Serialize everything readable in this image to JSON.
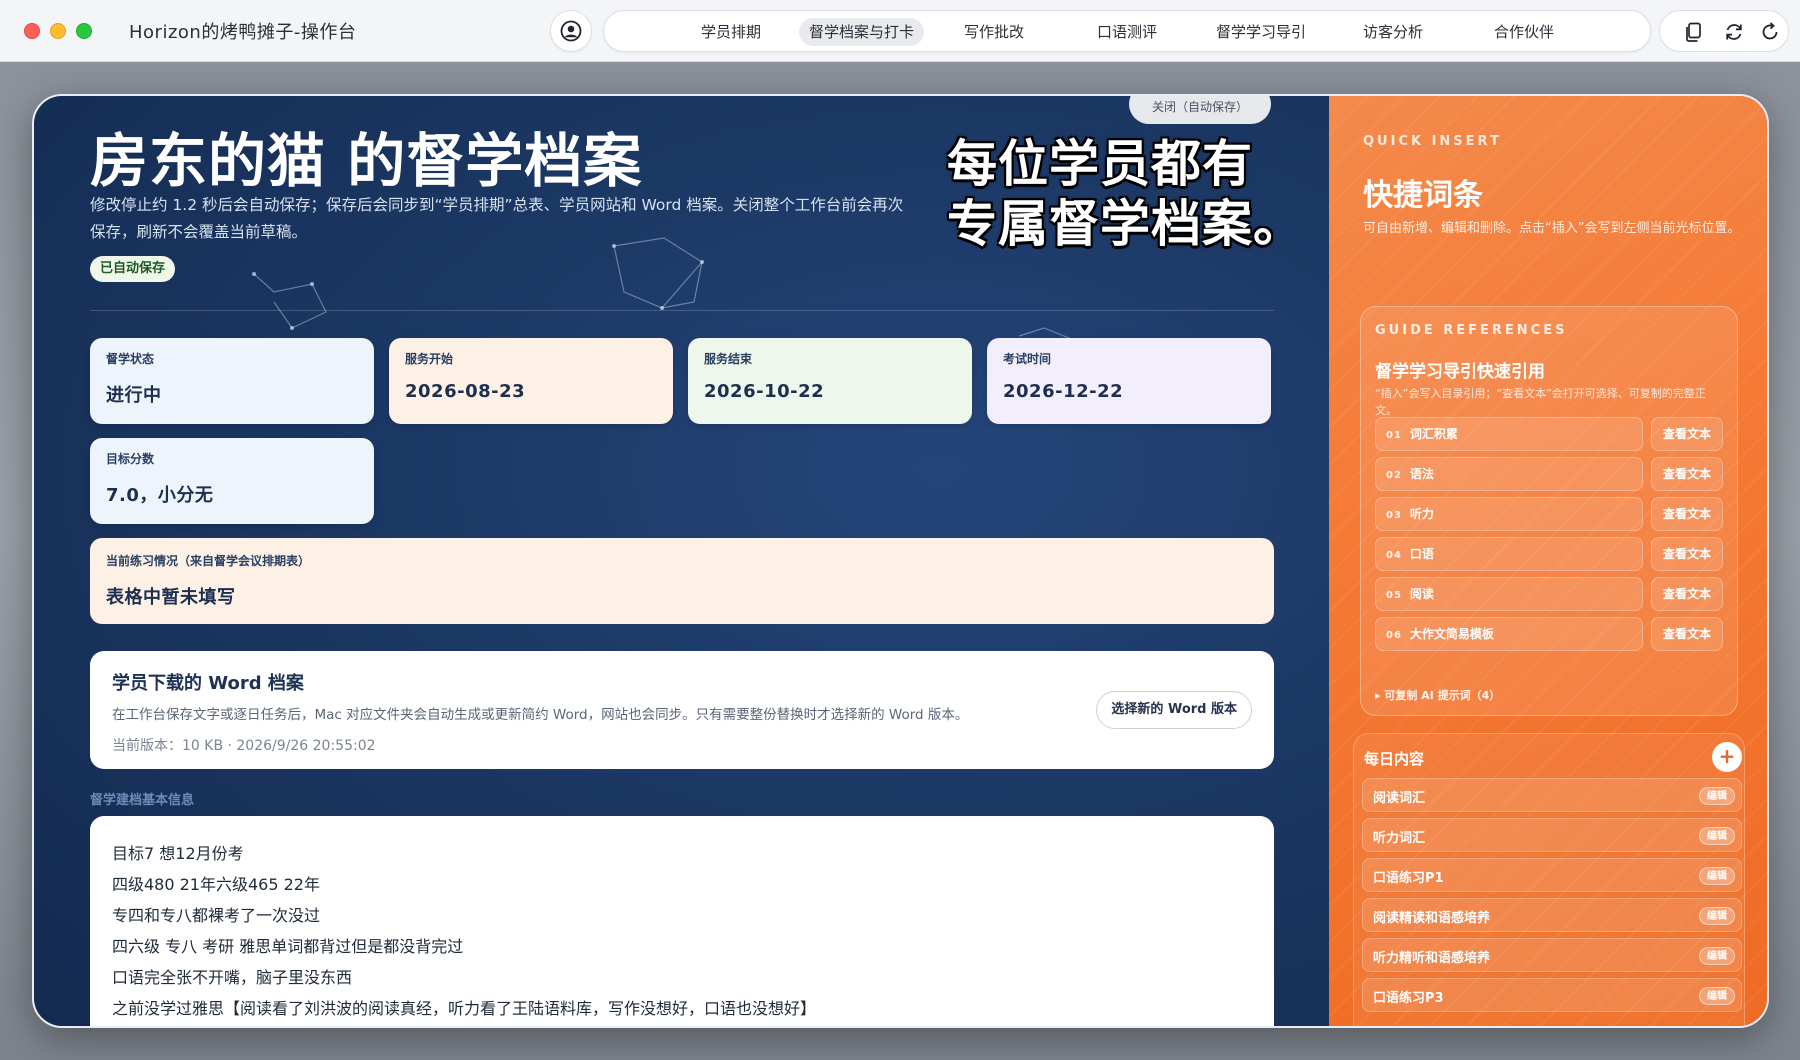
{
  "titlebar": {
    "app_title": "Horizon的烤鸭摊子-操作台",
    "nav": [
      "学员排期",
      "督学档案与打卡",
      "写作批改",
      "口语测评",
      "督学学习导引",
      "访客分析",
      "合作伙伴"
    ],
    "active_nav": "督学档案与打卡"
  },
  "main": {
    "close_label": "关闭（自动保存）",
    "title": "房东的猫 的督学档案",
    "description": "修改停止约 1.2 秒后会自动保存；保存后会同步到“学员排期”总表、学员网站和 Word 档案。关闭整个工作台前会再次保存，刷新不会覆盖当前草稿。",
    "saved_badge": "已自动保存",
    "overlay_caption_1": "每位学员都有",
    "overlay_caption_2": "专属督学档案。",
    "stats": [
      {
        "label": "督学状态",
        "value": "进行中"
      },
      {
        "label": "服务开始",
        "value": "2026-08-23"
      },
      {
        "label": "服务结束",
        "value": "2026-10-22"
      },
      {
        "label": "考试时间",
        "value": "2026-12-22"
      },
      {
        "label": "目标分数",
        "value": "7.0，小分无"
      }
    ],
    "practice": {
      "label": "当前练习情况（来自督学会议排期表）",
      "value": "表格中暂未填写"
    },
    "word_card": {
      "title": "学员下载的 Word 档案",
      "desc": "在工作台保存文字或逐日任务后，Mac 对应文件夹会自动生成或更新简约 Word，网站也会同步。只有需要整份替换时才选择新的 Word 版本。",
      "meta": "当前版本：10 KB · 2026/9/26 20:55:02",
      "button": "选择新的 Word 版本"
    },
    "basic_info_label": "督学建档基本信息",
    "basic_info_lines": [
      "目标7 想12月份考",
      "四级480 21年六级465 22年",
      "专四和专八都裸考了一次没过",
      "四六级 专八 考研 雅思单词都背过但是都没背完过",
      "口语完全张不开嘴，脑子里没东西",
      "之前没学过雅思【阅读看了刘洪波的阅读真经，听力看了王陆语料库，写作没想好，口语也没想好】"
    ]
  },
  "side": {
    "kicker": "QUICK INSERT",
    "title": "快捷词条",
    "desc": "可自由新增、编辑和删除。点击“插入”会写到左侧当前光标位置。",
    "guide": {
      "kicker": "GUIDE REFERENCES",
      "title": "督学学习导引快速引用",
      "desc": "“插入”会写入目录引用；“查看文本”会打开可选择、可复制的完整正文。",
      "items": [
        {
          "num": "01",
          "label": "词汇积累",
          "view": "查看文本"
        },
        {
          "num": "02",
          "label": "语法",
          "view": "查看文本"
        },
        {
          "num": "03",
          "label": "听力",
          "view": "查看文本"
        },
        {
          "num": "04",
          "label": "口语",
          "view": "查看文本"
        },
        {
          "num": "05",
          "label": "阅读",
          "view": "查看文本"
        },
        {
          "num": "06",
          "label": "大作文简易模板",
          "view": "查看文本"
        }
      ],
      "ai_prompts": "▸ 可复制 AI 提示词（4）"
    },
    "daily": {
      "title": "每日内容",
      "add": "+",
      "items": [
        {
          "label": "阅读词汇",
          "edit": "编辑"
        },
        {
          "label": "听力词汇",
          "edit": "编辑"
        },
        {
          "label": "口语练习P1",
          "edit": "编辑"
        },
        {
          "label": "阅读精读和语感培养",
          "edit": "编辑"
        },
        {
          "label": "听力精听和语感培养",
          "edit": "编辑"
        },
        {
          "label": "口语练习P3",
          "edit": "编辑"
        }
      ]
    }
  },
  "colors": {
    "main_bg": "#1b3763",
    "side_bg": "#f57a35",
    "accent": "#2b3f63"
  }
}
